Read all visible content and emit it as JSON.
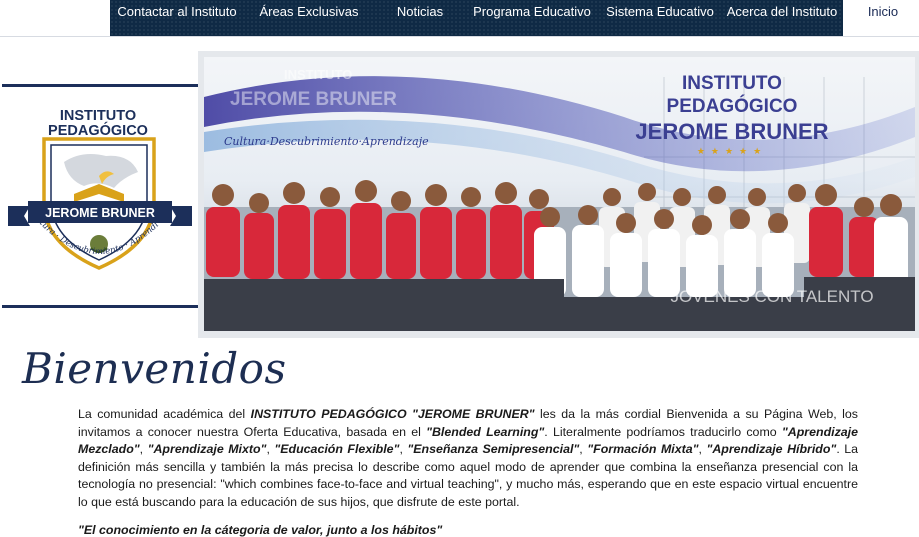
{
  "nav": {
    "items": [
      {
        "label": "Contactar al Instituto"
      },
      {
        "label": "Áreas Exclusivas"
      },
      {
        "label": "Noticias"
      },
      {
        "label": "Programa Educativo"
      },
      {
        "label": "Sistema Educativo"
      },
      {
        "label": "Acerca del Instituto"
      },
      {
        "label": "Inicio"
      }
    ]
  },
  "logo": {
    "line1": "INSTITUTO",
    "line2": "PEDAGÓGICO",
    "ribbon": "JEROME BRUNER",
    "motto": "Cultura · Descubrimiento · Aprendizaje"
  },
  "banner": {
    "title1": "INSTITUTO",
    "title2": "PEDAGÓGICO",
    "title3": "JEROME BRUNER",
    "ghost1": "INSTITUTO",
    "ghost2": "JEROME BRUNER",
    "tagline": "Cultura·Descubrimiento·Aprendizaje",
    "caption": "JOVENES CON TALENTO"
  },
  "welcome": {
    "title": "Bienvenidos",
    "t1": "La comunidad académica del ",
    "b1": "INSTITUTO PEDAGÓGICO \"JEROME BRUNER\"",
    "t2": " les da la más cordial Bienvenida a su Página Web, los invitamos a conocer nuestra Oferta Educativa, basada en el ",
    "b2": "\"Blended Learning\"",
    "t3": ". Literalmente podríamos traducirlo como ",
    "b3": "\"Aprendizaje Mezclado\"",
    "t4": ", ",
    "b4": "\"Aprendizaje Mixto\"",
    "t5": ", ",
    "b5": "\"Educación Flexible\"",
    "t6": ", ",
    "b6": "\"Enseñanza Semipresencial\"",
    "t7": ", ",
    "b7": "\"Formación Mixta\"",
    "t8": ", ",
    "b8": "\"Aprendizaje Híbrido\"",
    "t9": ". La definición más sencilla y también la más precisa lo describe como aquel modo de aprender que combina la enseñanza presencial con la tecnología no presencial: \"which combines face-to-face and virtual teaching\", y mucho más, esperando que en este espacio virtual encuentre lo que está buscando para la educación de sus hijos, que disfrute de este portal.",
    "quote": "\"El conocimiento en la cátegoria de valor, junto a los hábitos\""
  },
  "colors": {
    "navy": "#1c2f5a",
    "nav_bg": "#0f2a45",
    "gold": "#d9a21a",
    "student_red": "#d8283a"
  }
}
